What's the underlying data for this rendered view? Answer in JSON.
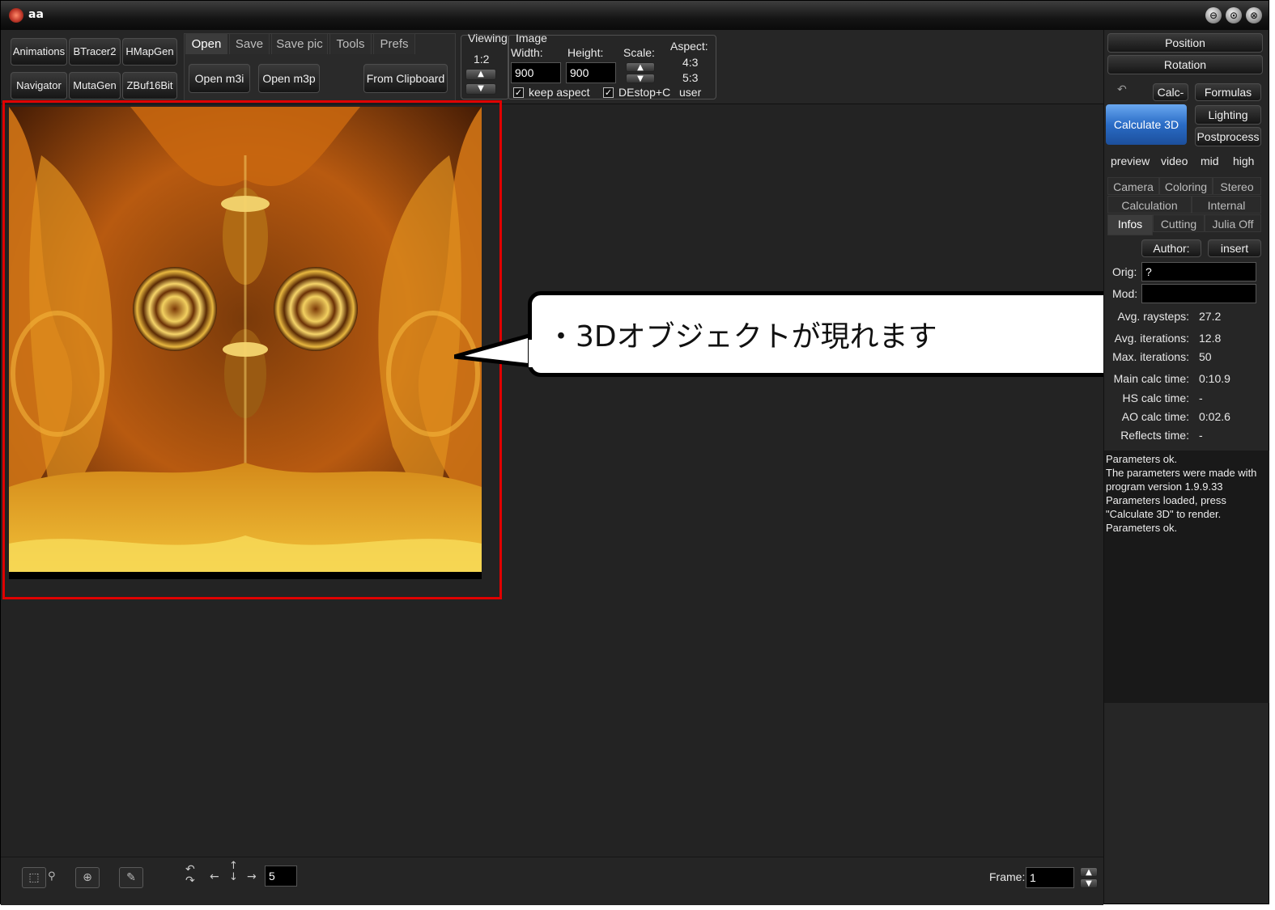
{
  "window": {
    "title": "aa",
    "minimize": "⊖",
    "restore": "⊙",
    "close": "⊗"
  },
  "toolbar": {
    "left_buttons": [
      "Animations",
      "BTracer2",
      "HMapGen",
      "Navigator",
      "MutaGen",
      "ZBuf16Bit"
    ],
    "tabs": [
      "Open",
      "Save",
      "Save pic",
      "Tools",
      "Prefs"
    ],
    "open_m3i": "Open m3i",
    "open_m3p": "Open m3p",
    "from_clipboard": "From Clipboard",
    "viewing_label": "Viewing",
    "viewing_value": "1:2",
    "image_label": "Image",
    "width_label": "Width:",
    "width_value": "900",
    "height_label": "Height:",
    "height_value": "900",
    "scale_label": "Scale:",
    "aspect_label": "Aspect:",
    "aspect_options": [
      "4:3",
      "5:3",
      "user"
    ],
    "keep_aspect": "keep aspect",
    "destop": "DEstop+C"
  },
  "callout": {
    "text": "・3Dオブジェクトが現れます"
  },
  "right_panel": {
    "position": "Position",
    "rotation": "Rotation",
    "calc_minus": "Calc-",
    "formulas": "Formulas",
    "calculate_3d": "Calculate 3D",
    "lighting": "Lighting",
    "postprocess": "Postprocess",
    "quality": [
      "preview",
      "video",
      "mid",
      "high"
    ],
    "tabs_row1": [
      "Camera",
      "Coloring",
      "Stereo"
    ],
    "tabs_row2": [
      "Calculation",
      "Internal"
    ],
    "tabs_row3": [
      "Infos",
      "Cutting",
      "Julia Off"
    ],
    "author": "Author:",
    "insert": "insert",
    "orig_label": "Orig:",
    "orig_value": "?",
    "mod_label": "Mod:",
    "mod_value": "",
    "info_rows": [
      {
        "label": "Avg. raysteps:",
        "value": "27.2"
      },
      {
        "label": "Avg. iterations:",
        "value": "12.8"
      },
      {
        "label": "Max. iterations:",
        "value": "50"
      },
      {
        "label": "Main calc time:",
        "value": "0:10.9"
      },
      {
        "label": "HS calc time:",
        "value": "-"
      },
      {
        "label": "AO calc time:",
        "value": "0:02.6"
      },
      {
        "label": "Reflects time:",
        "value": "-"
      }
    ],
    "log": [
      "Parameters ok.",
      "The parameters were made with",
      "program version 1.9.9.33",
      "Parameters loaded, press",
      "\"Calculate 3D\" to render.",
      "Parameters ok."
    ]
  },
  "bottom": {
    "step_value": "5",
    "frame_label": "Frame:",
    "frame_value": "1"
  },
  "colors": {
    "accent_blue": "#3a7fd6",
    "highlight_red": "#e00000"
  }
}
